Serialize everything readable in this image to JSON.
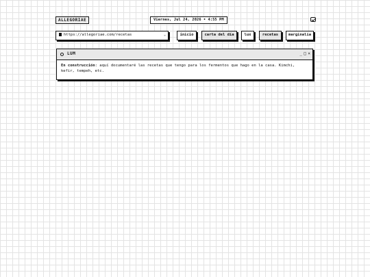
{
  "header": {
    "logo": "ALLEGORIAE",
    "datetime": "Viernes, Jul 24, 2026 • 4:55 PM",
    "mail_icon": "mail-icon"
  },
  "address_bar": {
    "url": "https://allegoriae.com/recetas",
    "page_icon": "page-icon",
    "caret": "⌄"
  },
  "nav": {
    "items": [
      {
        "label": "inicio"
      },
      {
        "label": "carta del día"
      },
      {
        "label": "lux"
      },
      {
        "label": "recetas"
      },
      {
        "label": "marginalia"
      }
    ]
  },
  "window": {
    "title": "LUM",
    "minimize": "_",
    "maximize": "□",
    "close": "×",
    "body_bold": "En construcción",
    "body_text": ": aquí documentaré las recetas que tengo para los fermentos que hago en la casa. Kimchi, kefir, tempeh, etc."
  }
}
